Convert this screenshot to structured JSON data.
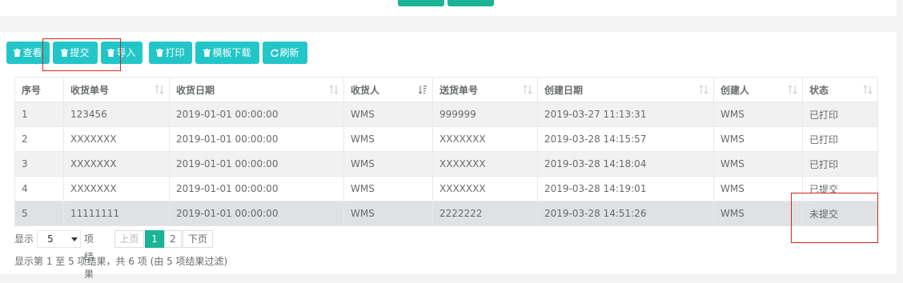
{
  "toolbar": {
    "view_label": "查看",
    "submit_label": "提交",
    "import_label": "导入",
    "print_label": "打印",
    "template_download_label": "模板下载",
    "refresh_label": "刷新",
    "button_color": "#23c6c8"
  },
  "table": {
    "columns": [
      "序号",
      "收货单号",
      "收货日期",
      "收货人",
      "送货单号",
      "创建日期",
      "创建人",
      "状态"
    ],
    "rows": [
      [
        "1",
        "123456",
        "2019-01-01 00:00:00",
        "WMS",
        "999999",
        "2019-03-27 11:13:31",
        "WMS",
        "已打印"
      ],
      [
        "2",
        "XXXXXXX",
        "2019-01-01 00:00:00",
        "WMS",
        "XXXXXXX",
        "2019-03-28 14:15:57",
        "WMS",
        "已打印"
      ],
      [
        "3",
        "XXXXXXX",
        "2019-01-01 00:00:00",
        "WMS",
        "XXXXXXX",
        "2019-03-28 14:18:04",
        "WMS",
        "已打印"
      ],
      [
        "4",
        "XXXXXXX",
        "2019-01-01 00:00:00",
        "WMS",
        "XXXXXXX",
        "2019-03-28 14:19:01",
        "WMS",
        "已提交"
      ],
      [
        "5",
        "11111111",
        "2019-01-01 00:00:00",
        "WMS",
        "2222222",
        "2019-03-28 14:51:26",
        "WMS",
        "未提交"
      ]
    ],
    "selected_row": 5
  },
  "paging": {
    "show_label": "显示",
    "page_length": "5",
    "per_page_suffix": "项结果",
    "prev_label": "上页",
    "next_label": "下页",
    "page_1": "1",
    "page_2": "2",
    "current_page": 1,
    "accent_color": "#1ab394"
  },
  "info_text": "显示第 1 至 5 项结果，共 6 项 (由 5 项结果过滤)"
}
